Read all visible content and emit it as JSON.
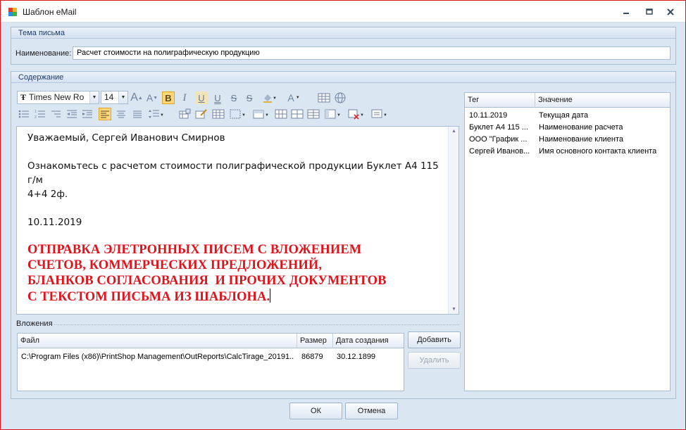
{
  "window": {
    "title": "Шаблон eMail"
  },
  "subject_group": {
    "header": "Тема письма",
    "name_label": "Наименование:",
    "name_value": "Расчет стоимости на полиграфическую продукцию"
  },
  "content_group": {
    "header": "Содержание"
  },
  "toolbar": {
    "font_name": "Times New Ro",
    "font_size": "14",
    "bold_glyph": "B",
    "italic_glyph": "I",
    "underline_glyph": "U",
    "double_underline_glyph": "U",
    "strike_glyph": "S",
    "font_color_glyph": "A"
  },
  "editor": {
    "greeting": "Уважаемый, Сергей Иванович Смирнов",
    "body_line1": "Ознакомьтесь с расчетом стоимости полиграфической продукции Буклет А4 115 г/м",
    "body_line2": "4+4 2ф.",
    "date": "10.11.2019",
    "red_lines": [
      "ОТПРАВКА ЭЛЕТРОННЫХ ПИСЕМ С ВЛОЖЕНИЕМ",
      "СЧЕТОВ, КОММЕРЧЕСКИХ ПРЕДЛОЖЕНИЙ,",
      "БЛАНКОВ СОГЛАСОВАНИЯ  И ПРОЧИХ ДОКУМЕНТОВ",
      "С ТЕКСТОМ ПИСЬМА ИЗ ШАБЛОНА."
    ],
    "red_color": "#e2121b"
  },
  "attachments": {
    "label": "Вложения",
    "columns": [
      "Файл",
      "Размер",
      "Дата создания"
    ],
    "rows": [
      {
        "file": "C:\\Program Files (x86)\\PrintShop Management\\OutReports\\CalcTirage_20191...",
        "size": "86879",
        "date": "30.12.1899"
      }
    ],
    "add_label": "Добавить",
    "delete_label": "Удалить"
  },
  "tags": {
    "columns": [
      "Тег",
      "Значение"
    ],
    "rows": [
      {
        "tag": "10.11.2019",
        "value": "Текущая дата"
      },
      {
        "tag": "Буклет А4 115 ...",
        "value": "Наименование расчета"
      },
      {
        "tag": "ООО \"График ...",
        "value": "Наименование клиента"
      },
      {
        "tag": "Сергей Иванов...",
        "value": "Имя основного контакта клиента"
      }
    ]
  },
  "footer": {
    "ok_label": "ОК",
    "cancel_label": "Отмена"
  }
}
